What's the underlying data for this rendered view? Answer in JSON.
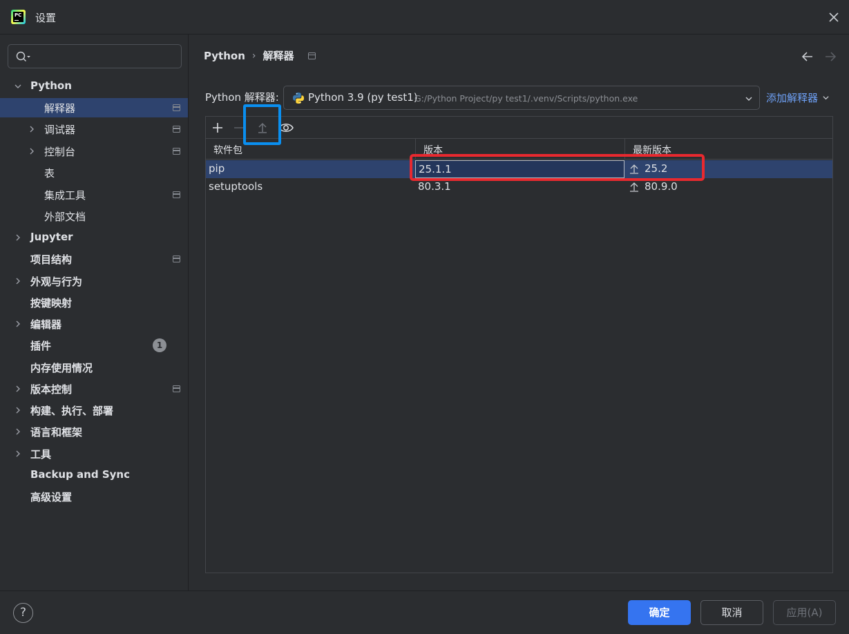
{
  "window": {
    "title": "设置",
    "app_icon_text": "PC"
  },
  "search": {
    "value": "",
    "placeholder": ""
  },
  "sidebar": {
    "items": [
      {
        "label": "Python",
        "bold": true,
        "expanded": true
      },
      {
        "label": "解释器",
        "selected": true
      },
      {
        "label": "调试器"
      },
      {
        "label": "控制台"
      },
      {
        "label": "表"
      },
      {
        "label": "集成工具"
      },
      {
        "label": "外部文档"
      },
      {
        "label": "Jupyter"
      },
      {
        "label": "项目结构"
      },
      {
        "label": "外观与行为"
      },
      {
        "label": "按键映射"
      },
      {
        "label": "编辑器"
      },
      {
        "label": "插件",
        "badge": "1"
      },
      {
        "label": "内存使用情况"
      },
      {
        "label": "版本控制"
      },
      {
        "label": "构建、执行、部署"
      },
      {
        "label": "语言和框架"
      },
      {
        "label": "工具"
      },
      {
        "label": "Backup and Sync"
      },
      {
        "label": "高级设置"
      }
    ]
  },
  "breadcrumb": {
    "root": "Python",
    "separator": "›",
    "current": "解释器"
  },
  "interpreter": {
    "label": "Python 解释器:",
    "name": "Python 3.9 (py test1)",
    "path": "G:/Python Project/py test1/.venv/Scripts/python.exe",
    "add_label": "添加解释器"
  },
  "packages": {
    "columns": [
      "软件包",
      "版本",
      "最新版本"
    ],
    "rows": [
      {
        "name": "pip",
        "version": "25.1.1",
        "latest": "25.2"
      },
      {
        "name": "setuptools",
        "version": "80.3.1",
        "latest": "80.9.0"
      }
    ]
  },
  "footer": {
    "help": "?",
    "ok_label": "确定",
    "cancel_label": "取消",
    "apply_label": "应用(A)"
  },
  "colors": {
    "background": "#2b2d30",
    "selection": "#2e436e",
    "accent": "#3574f0",
    "link": "#6ea0f5",
    "highlight_blue": "#0a8ff0",
    "highlight_red": "#e8292f"
  }
}
